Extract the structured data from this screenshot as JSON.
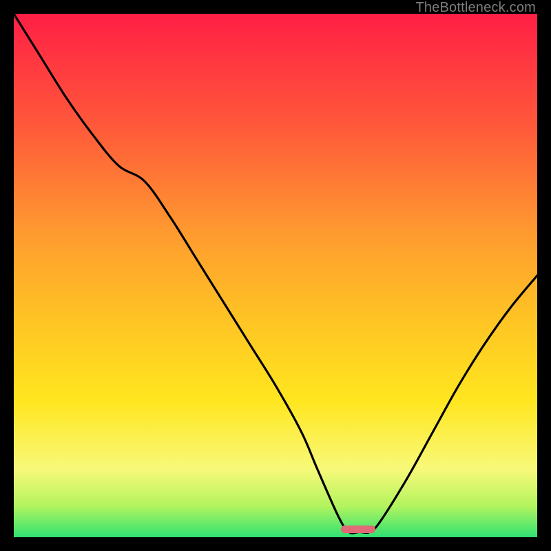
{
  "watermark": "TheBottleneck.com",
  "colors": {
    "red": "#ff1f45",
    "orange_red": "#ff5a3a",
    "orange": "#ff9b2f",
    "yellow_o": "#ffc324",
    "yellow": "#ffe61f",
    "pale": "#f8f97a",
    "lime": "#b3f45e",
    "green": "#2fe273",
    "marker": "#e06a77",
    "curve": "#000000"
  },
  "marker": {
    "left_frac": 0.625,
    "width_frac": 0.066,
    "bottom_frac": 0.992
  },
  "chart_data": {
    "type": "line",
    "title": "",
    "xlabel": "",
    "ylabel": "",
    "xlim": [
      0,
      100
    ],
    "ylim": [
      0,
      100
    ],
    "x": [
      0,
      5,
      10,
      15,
      20,
      25,
      30,
      35,
      40,
      45,
      50,
      55,
      58,
      62,
      64,
      66,
      68,
      70,
      75,
      80,
      85,
      90,
      95,
      100
    ],
    "values": [
      100,
      92,
      84,
      77,
      71,
      68,
      61,
      53,
      45,
      37,
      29,
      20,
      13,
      4,
      1,
      1,
      1,
      3,
      11,
      20,
      29,
      37,
      44,
      50
    ],
    "note": "x is horizontal position (% of plot width, left→right); values are height (% of plot, 0=bottom 100=top). Values are visual estimates — the source image has no axes or tick labels."
  }
}
